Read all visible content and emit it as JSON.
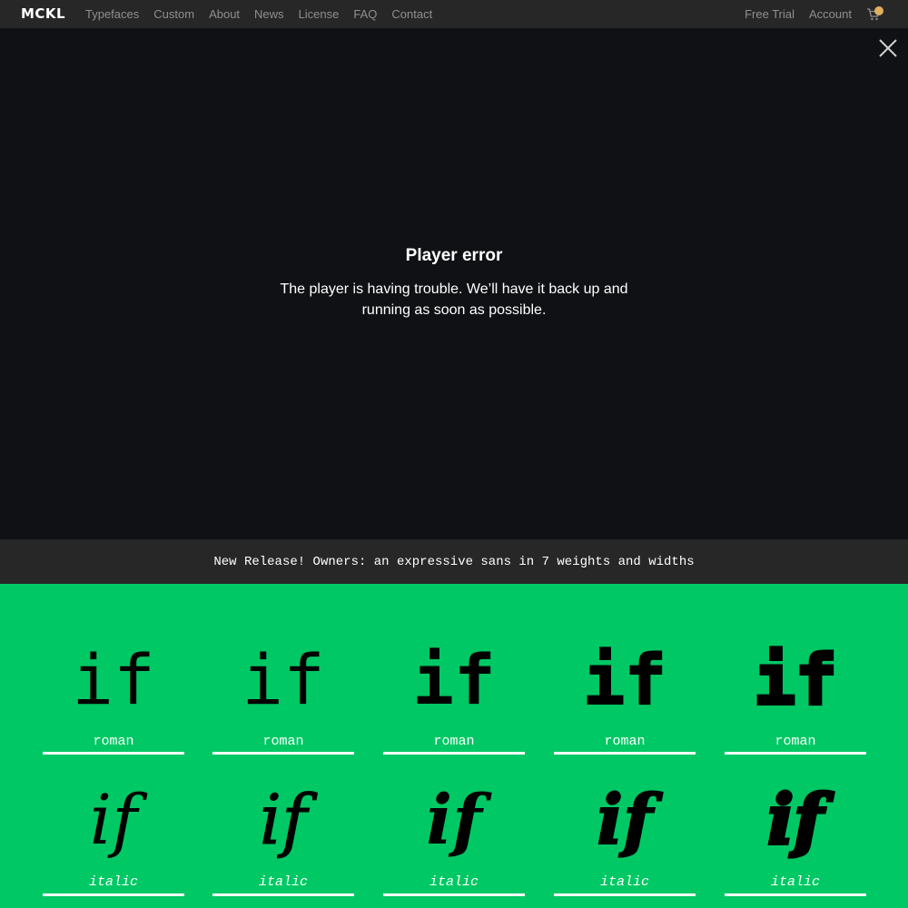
{
  "nav": {
    "logo": "MCKL",
    "left_links": [
      "Typefaces",
      "Custom",
      "About",
      "News",
      "License",
      "FAQ",
      "Contact"
    ],
    "free_trial": "Free Trial",
    "account": "Account"
  },
  "player": {
    "error_title": "Player error",
    "error_message": "The player is having trouble. We’ll have it back up and running as soon as possible."
  },
  "banner": {
    "text": "New Release! Owners: an expressive sans in 7 weights and widths"
  },
  "specimens": {
    "glyph": "if",
    "roman": [
      {
        "label": "roman"
      },
      {
        "label": "roman"
      },
      {
        "label": "roman"
      },
      {
        "label": "roman"
      },
      {
        "label": "roman"
      }
    ],
    "italic": [
      {
        "label": "italic"
      },
      {
        "label": "italic"
      },
      {
        "label": "italic"
      },
      {
        "label": "italic"
      },
      {
        "label": "italic"
      }
    ]
  },
  "colors": {
    "nav_bg": "#272727",
    "player_bg": "#101114",
    "grid_bg": "#00c864",
    "cart_badge": "#e0b060"
  }
}
